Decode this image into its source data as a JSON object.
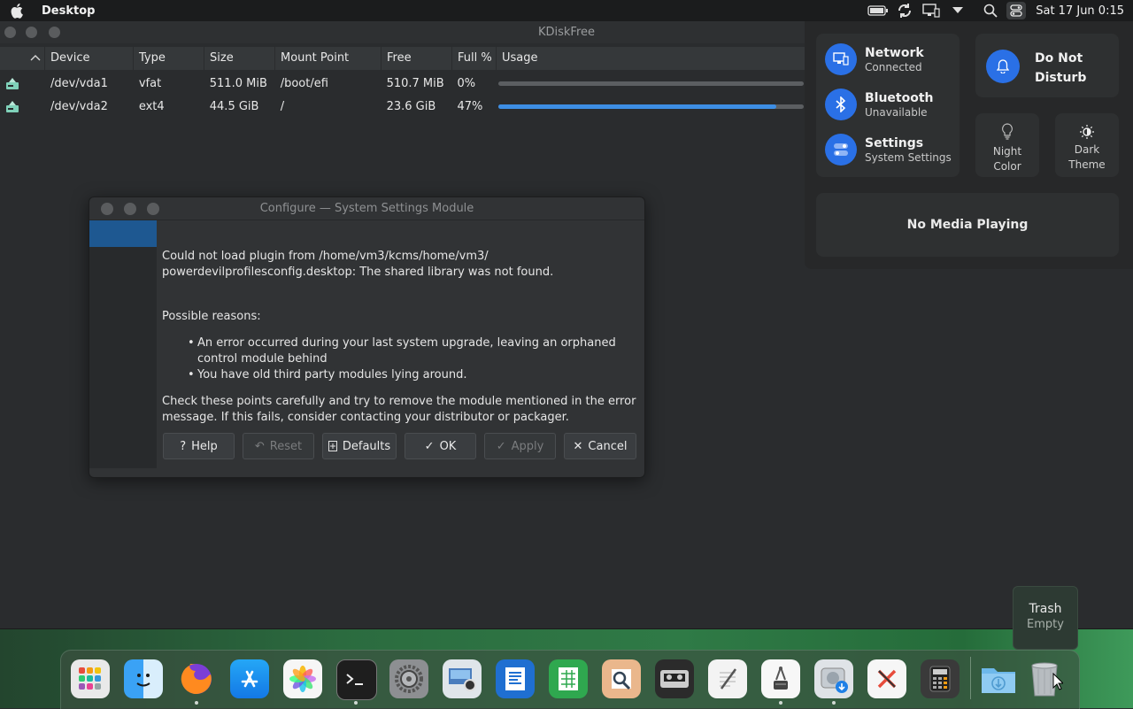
{
  "topbar": {
    "app_title": "Desktop",
    "clock": "Sat 17 Jun 0:15"
  },
  "kdiskfree": {
    "title": "KDiskFree",
    "columns": [
      "Device",
      "Type",
      "Size",
      "Mount Point",
      "Free",
      "Full %",
      "Usage"
    ],
    "rows": [
      {
        "device": "/dev/vda1",
        "type": "vfat",
        "size": "511.0 MiB",
        "mount": "/boot/efi",
        "free": "510.7 MiB",
        "full": "0%",
        "usage": 0.0
      },
      {
        "device": "/dev/vda2",
        "type": "ext4",
        "size": "44.5 GiB",
        "mount": "/",
        "free": "23.6 GiB",
        "full": "47%",
        "usage": 0.91
      }
    ]
  },
  "dialog": {
    "title": "Configure — System Settings Module",
    "error_line1": "Could not load plugin from /home/vm3/kcms/home/vm3/",
    "error_line2": "powerdevilprofilesconfig.desktop: The shared library was not found.",
    "reasons_heading": "Possible reasons:",
    "reason1": "An error occurred during your last system upgrade, leaving an orphaned control module behind",
    "reason2": "You have old third party modules lying around.",
    "advice": "Check these points carefully and try to remove the module mentioned in the error message. If this fails, consider contacting your distributor or packager.",
    "buttons": {
      "help": "Help",
      "reset": "Reset",
      "defaults": "Defaults",
      "ok": "OK",
      "apply": "Apply",
      "cancel": "Cancel"
    }
  },
  "control_center": {
    "network": {
      "title": "Network",
      "status": "Connected"
    },
    "bluetooth": {
      "title": "Bluetooth",
      "status": "Unavailable"
    },
    "settings": {
      "title": "Settings",
      "status": "System Settings"
    },
    "dnd": {
      "line1": "Do Not",
      "line2": "Disturb"
    },
    "night": {
      "line1": "Night",
      "line2": "Color"
    },
    "dark": {
      "line1": "Dark",
      "line2": "Theme"
    },
    "media": "No Media Playing",
    "accent": "#2a70e6"
  },
  "trash_tooltip": {
    "title": "Trash",
    "status": "Empty"
  },
  "dock": {
    "items": [
      "launcher-icon",
      "finder-icon",
      "firefox-icon",
      "app-store-icon",
      "photos-icon",
      "terminal-icon",
      "system-preferences-icon",
      "screenshot-icon",
      "writer-icon",
      "calc-sheet-icon",
      "preview-icon",
      "tape-icon",
      "notes-icon",
      "kdiskfree-icon",
      "disk-utility-icon",
      "xcode-icon",
      "calculator-icon",
      "downloads-folder-icon",
      "trash-icon"
    ]
  }
}
